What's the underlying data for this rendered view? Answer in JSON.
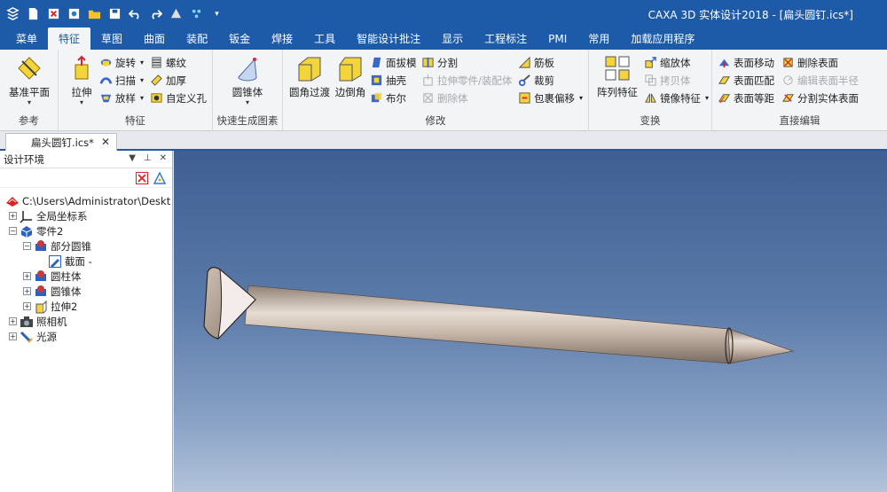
{
  "window": {
    "title": "CAXA 3D 实体设计2018 - [扁头圆钉.ics*]"
  },
  "quick_access": [
    "app-menu-icon",
    "new-icon",
    "close-doc-icon",
    "open-icon",
    "folder-icon",
    "save-icon",
    "undo-icon",
    "redo-icon",
    "render-icon",
    "design-env-icon",
    "more-icon"
  ],
  "tabs": [
    "菜单",
    "特征",
    "草图",
    "曲面",
    "装配",
    "钣金",
    "焊接",
    "工具",
    "智能设计批注",
    "显示",
    "工程标注",
    "PMI",
    "常用",
    "加载应用程序"
  ],
  "active_tab": "特征",
  "ribbon": {
    "groups": {
      "reference": "参考",
      "feature": "特征",
      "quick_shape": "快速生成图素",
      "modify": "修改",
      "transform": "变换",
      "direct_edit": "直接编辑"
    },
    "buttons": {
      "datum_plane": "基准平面",
      "extrude": "拉伸",
      "revolve": "旋转",
      "sweep": "扫描",
      "loft": "放样",
      "thread": "螺纹",
      "thicken": "加厚",
      "custom_hole": "自定义孔",
      "cone": "圆锥体",
      "fillet": "圆角过渡",
      "chamfer": "边倒角",
      "draft": "面拔模",
      "shell": "抽壳",
      "boolean": "布尔",
      "split": "分割",
      "extrude_part": "拉伸零件/装配体",
      "delete_body": "删除体",
      "rib": "筋板",
      "trim": "裁剪",
      "wrap_offset": "包裹偏移",
      "pattern": "阵列特征",
      "scale": "缩放体",
      "copy": "拷贝体",
      "mirror": "镜像特征",
      "face_move": "表面移动",
      "face_match": "表面匹配",
      "face_offset": "表面等距",
      "delete_face": "删除表面",
      "edit_radius": "编辑表面半径",
      "split_solid": "分割实体表面"
    }
  },
  "document_tab": "扁头圆钉.ics*",
  "panel": {
    "title": "设计环境",
    "tree": [
      {
        "label": "C:\\Users\\Administrator\\Deskt",
        "level": 0,
        "expander": "",
        "icon": "design-env-icon"
      },
      {
        "label": "全局坐标系",
        "level": 1,
        "expander": "+",
        "icon": "axes-icon"
      },
      {
        "label": "零件2",
        "level": 1,
        "expander": "−",
        "icon": "part-icon"
      },
      {
        "label": "部分圆锥",
        "level": 2,
        "expander": "−",
        "icon": "shape-icon"
      },
      {
        "label": "截面 -",
        "level": 3,
        "expander": "",
        "icon": "section-icon"
      },
      {
        "label": "圆柱体",
        "level": 2,
        "expander": "+",
        "icon": "shape-icon"
      },
      {
        "label": "圆锥体",
        "level": 2,
        "expander": "+",
        "icon": "shape-icon"
      },
      {
        "label": "拉伸2",
        "level": 2,
        "expander": "+",
        "icon": "extrude-icon"
      },
      {
        "label": "照相机",
        "level": 1,
        "expander": "+",
        "icon": "camera-icon"
      },
      {
        "label": "光源",
        "level": 1,
        "expander": "+",
        "icon": "light-icon"
      }
    ]
  },
  "colors": {
    "titlebar": "#1d5aa8",
    "ribbon_bg": "#f3f4f6",
    "viewport_top": "#3f5f93",
    "viewport_bottom": "#b3c3da",
    "model": "#b9a89a"
  }
}
